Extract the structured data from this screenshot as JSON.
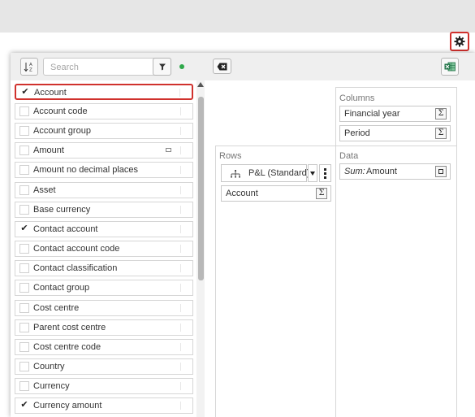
{
  "toolbar": {
    "search": {
      "placeholder": "Search",
      "value": ""
    }
  },
  "fields": [
    {
      "label": "Account",
      "checked": true
    },
    {
      "label": "Account code",
      "checked": false
    },
    {
      "label": "Account group",
      "checked": false
    },
    {
      "label": "Amount",
      "checked": false
    },
    {
      "label": "Amount no decimal places",
      "checked": false
    },
    {
      "label": "Asset",
      "checked": false
    },
    {
      "label": "Base currency",
      "checked": false
    },
    {
      "label": "Contact account",
      "checked": true
    },
    {
      "label": "Contact account code",
      "checked": false
    },
    {
      "label": "Contact classification",
      "checked": false
    },
    {
      "label": "Contact group",
      "checked": false
    },
    {
      "label": "Cost centre",
      "checked": false
    },
    {
      "label": "Parent cost centre",
      "checked": false
    },
    {
      "label": "Cost centre code",
      "checked": false
    },
    {
      "label": "Country",
      "checked": false
    },
    {
      "label": "Currency",
      "checked": false
    },
    {
      "label": "Currency amount",
      "checked": true
    }
  ],
  "check_glyph": "✔",
  "zones": {
    "columns": {
      "title": "Columns",
      "items": [
        "Financial year",
        "Period"
      ]
    },
    "rows": {
      "title": "Rows",
      "hierarchy": "P&L (Standard)",
      "items": [
        "Account"
      ]
    },
    "data": {
      "title": "Data",
      "agg": "Sum:",
      "field": "Amount"
    }
  },
  "sigma": "Σ",
  "icons": {
    "settings": "gear-icon",
    "sort": "sort-az-icon",
    "filter": "filter-icon",
    "clear": "clear-icon",
    "excel": "excel-icon",
    "hierarchy": "hierarchy-icon"
  },
  "colors": {
    "highlight": "#d0312d",
    "status_dot": "#2ea84a",
    "excel": "#1e7145"
  }
}
